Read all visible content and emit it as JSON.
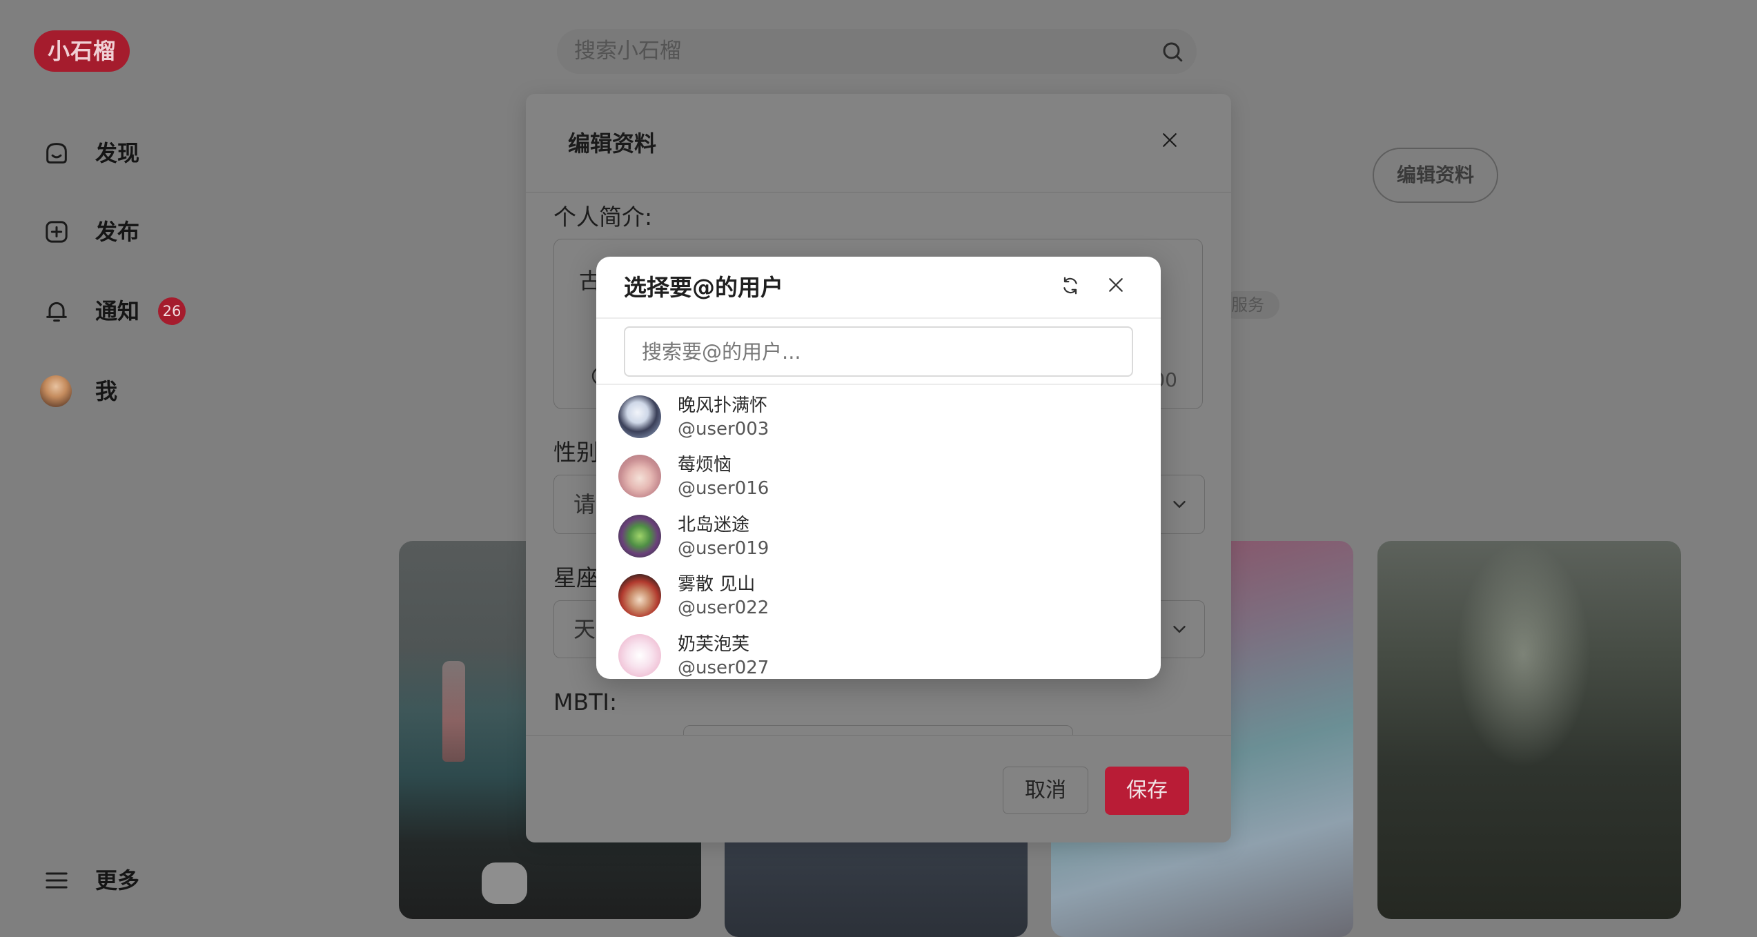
{
  "theme": {
    "page_bg": "#7f7f7f",
    "brand": "#a51c2d",
    "save": "#b91c36"
  },
  "app": {
    "logo_text": "小石榴"
  },
  "search": {
    "placeholder": "搜索小石榴",
    "icon": "search-icon"
  },
  "sidebar": {
    "items": [
      {
        "label": "发现",
        "icon": "home-icon"
      },
      {
        "label": "发布",
        "icon": "plus-square-icon"
      },
      {
        "label": "通知",
        "icon": "bell-icon",
        "badge": "26"
      },
      {
        "label": "我",
        "icon": "avatar"
      }
    ],
    "more_label": "更多",
    "more_icon": "menu-icon"
  },
  "profile": {
    "edit_button_label": "编辑资料",
    "tag_text": "服务"
  },
  "edit_modal": {
    "title": "编辑资料",
    "bio_label": "个人简介:",
    "bio_value": "古",
    "bio_count": "00",
    "gender_label": "性别",
    "gender_value": "请",
    "zodiac_label": "星座",
    "zodiac_value": "天",
    "mbti_label": "MBTI:",
    "cancel_label": "取消",
    "save_label": "保存"
  },
  "mention_dialog": {
    "title": "选择要@的用户",
    "search_placeholder": "搜索要@的用户...",
    "users": [
      {
        "name": "晚风扑满怀",
        "handle": "@user003"
      },
      {
        "name": "莓烦恼",
        "handle": "@user016"
      },
      {
        "name": "北岛迷途",
        "handle": "@user019"
      },
      {
        "name": "雾散 见山",
        "handle": "@user022"
      },
      {
        "name": "奶芙泡芙",
        "handle": "@user027"
      }
    ]
  }
}
